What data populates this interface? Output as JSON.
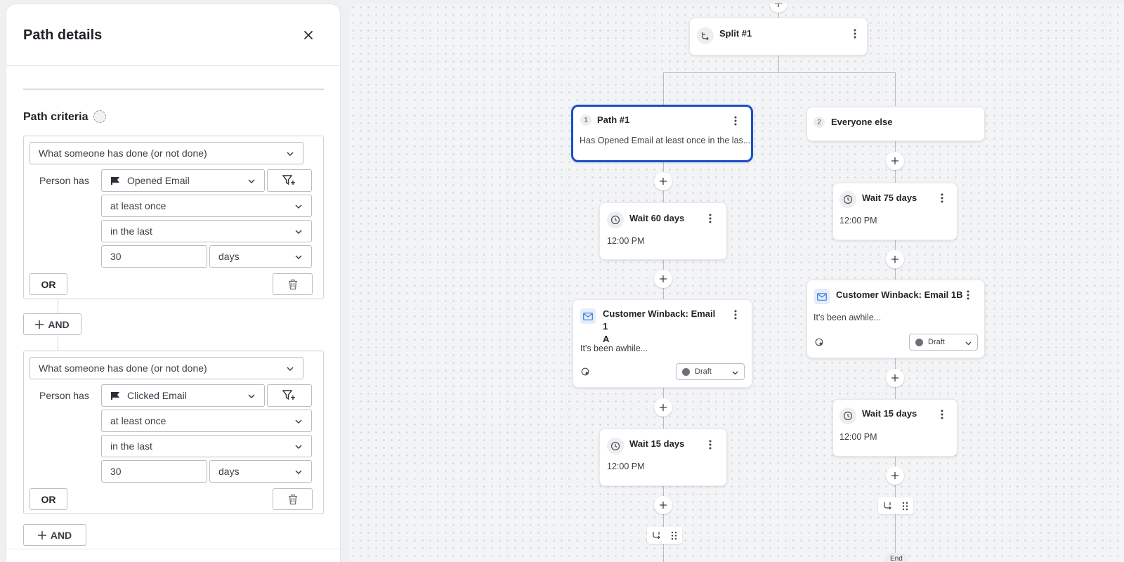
{
  "panel": {
    "title": "Path details",
    "criteria_title": "Path criteria",
    "groups": [
      {
        "type_select": "What someone has done (or not done)",
        "person_has_label": "Person has",
        "metric": "Opened Email",
        "frequency": "at least once",
        "timeframe": "in the last",
        "amount": "30",
        "unit": "days",
        "or_label": "OR"
      },
      {
        "type_select": "What someone has done (or not done)",
        "person_has_label": "Person has",
        "metric": "Clicked Email",
        "frequency": "at least once",
        "timeframe": "in the last",
        "amount": "30",
        "unit": "days",
        "or_label": "OR"
      }
    ],
    "and_label": "AND"
  },
  "canvas": {
    "split": {
      "title": "Split #1"
    },
    "path1": {
      "number": "1",
      "title": "Path #1",
      "description": "Has Opened Email at least once in the las..."
    },
    "path2": {
      "number": "2",
      "title": "Everyone else"
    },
    "left_wait1": {
      "title": "Wait 60 days",
      "time": "12:00 PM"
    },
    "left_email": {
      "title_line1": "Customer Winback: Email 1",
      "title_line2": "A",
      "preview": "It's been awhile...",
      "status": "Draft"
    },
    "left_wait2": {
      "title": "Wait 15 days",
      "time": "12:00 PM"
    },
    "right_wait1": {
      "title": "Wait 75 days",
      "time": "12:00 PM"
    },
    "right_email": {
      "title": "Customer Winback: Email 1B",
      "preview": "It's been awhile...",
      "status": "Draft"
    },
    "right_wait2": {
      "title": "Wait 15 days",
      "time": "12:00 PM"
    },
    "end_label": "End"
  },
  "colors": {
    "accent_selected": "#1a4fc9",
    "canvas_bg": "#f3f4f6",
    "line": "#b8bcc1"
  }
}
